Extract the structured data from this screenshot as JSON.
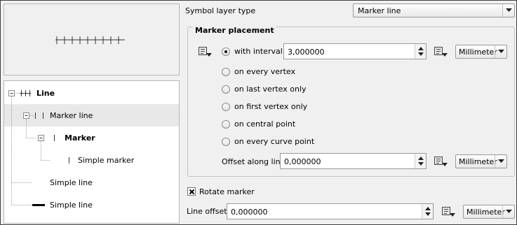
{
  "tree": {
    "items": [
      {
        "label": "Line"
      },
      {
        "label": "Marker line"
      },
      {
        "label": "Marker"
      },
      {
        "label": "Simple marker"
      },
      {
        "label": "Simple line"
      },
      {
        "label": "Simple line"
      }
    ]
  },
  "symbol_layer": {
    "label": "Symbol layer type",
    "value": "Marker line"
  },
  "marker_placement": {
    "title": "Marker placement",
    "options": [
      {
        "label": "with interval",
        "checked": true
      },
      {
        "label": "on every vertex",
        "checked": false
      },
      {
        "label": "on last vertex only",
        "checked": false
      },
      {
        "label": "on first vertex only",
        "checked": false
      },
      {
        "label": "on central point",
        "checked": false
      },
      {
        "label": "on every curve point",
        "checked": false
      }
    ],
    "interval_value": "3,000000",
    "interval_unit": "Millimeter",
    "offset_label": "Offset along line",
    "offset_value": "0,000000",
    "offset_unit": "Millimeter"
  },
  "rotate_marker": {
    "label": "Rotate marker",
    "checked": true
  },
  "line_offset": {
    "label": "Line offset",
    "value": "0,000000",
    "unit": "Millimeter"
  },
  "icons": {
    "data_defined": "data-defined-override-icon",
    "expand": "tree-expand-icon",
    "dropdown": "chevron-down-icon"
  }
}
